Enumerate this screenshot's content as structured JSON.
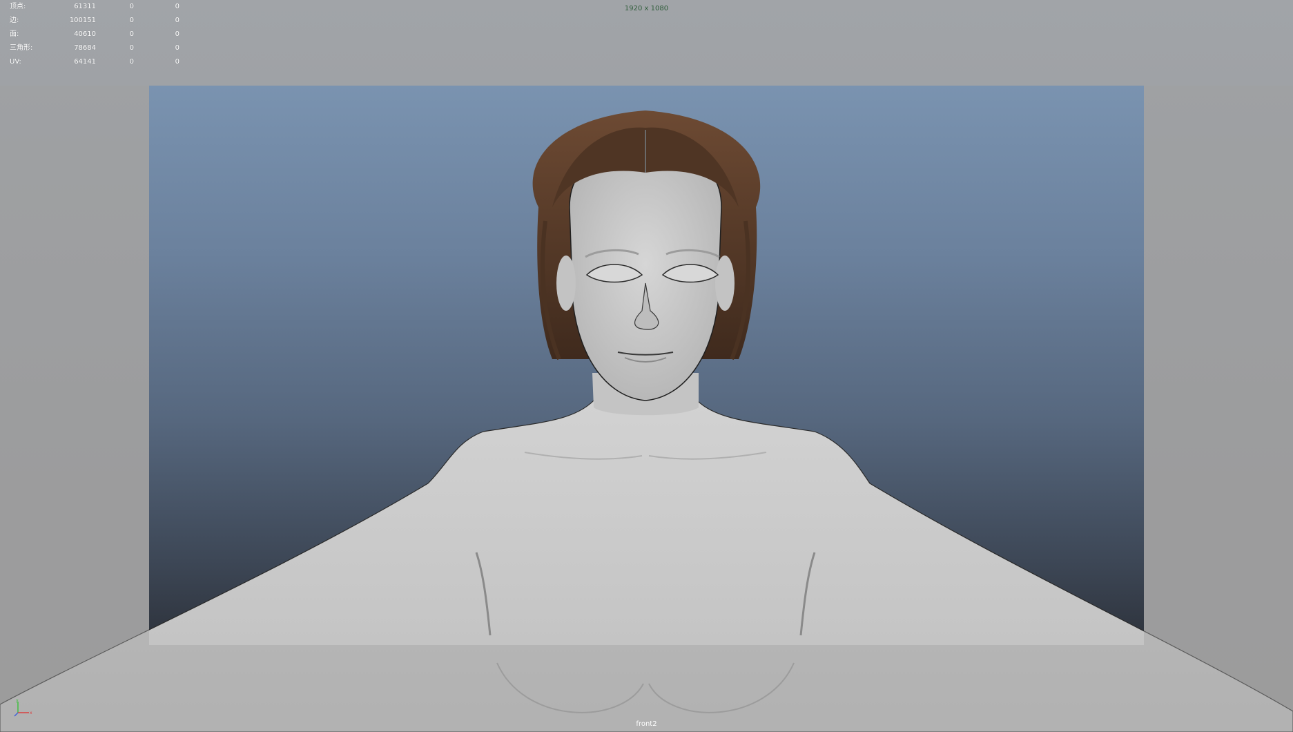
{
  "hud": {
    "rows": [
      {
        "label": "顶点:",
        "value": "61311",
        "sel": "0",
        "tri": "0"
      },
      {
        "label": "边:",
        "value": "100151",
        "sel": "0",
        "tri": "0"
      },
      {
        "label": "面:",
        "value": "40610",
        "sel": "0",
        "tri": "0"
      },
      {
        "label": "三角形:",
        "value": "78684",
        "sel": "0",
        "tri": "0"
      },
      {
        "label": "UV:",
        "value": "64141",
        "sel": "0",
        "tri": "0"
      }
    ]
  },
  "viewport": {
    "resolution": "1920 x 1080",
    "camera": "front2"
  },
  "axis": {
    "x": "x",
    "y": "y",
    "z": "z"
  },
  "colors": {
    "background_top": "#7a93b0",
    "background_bottom": "#2d323b",
    "skin": "#c9c9c9",
    "hair": "#5a3e2b",
    "resolution_text": "#2f5d3a"
  }
}
